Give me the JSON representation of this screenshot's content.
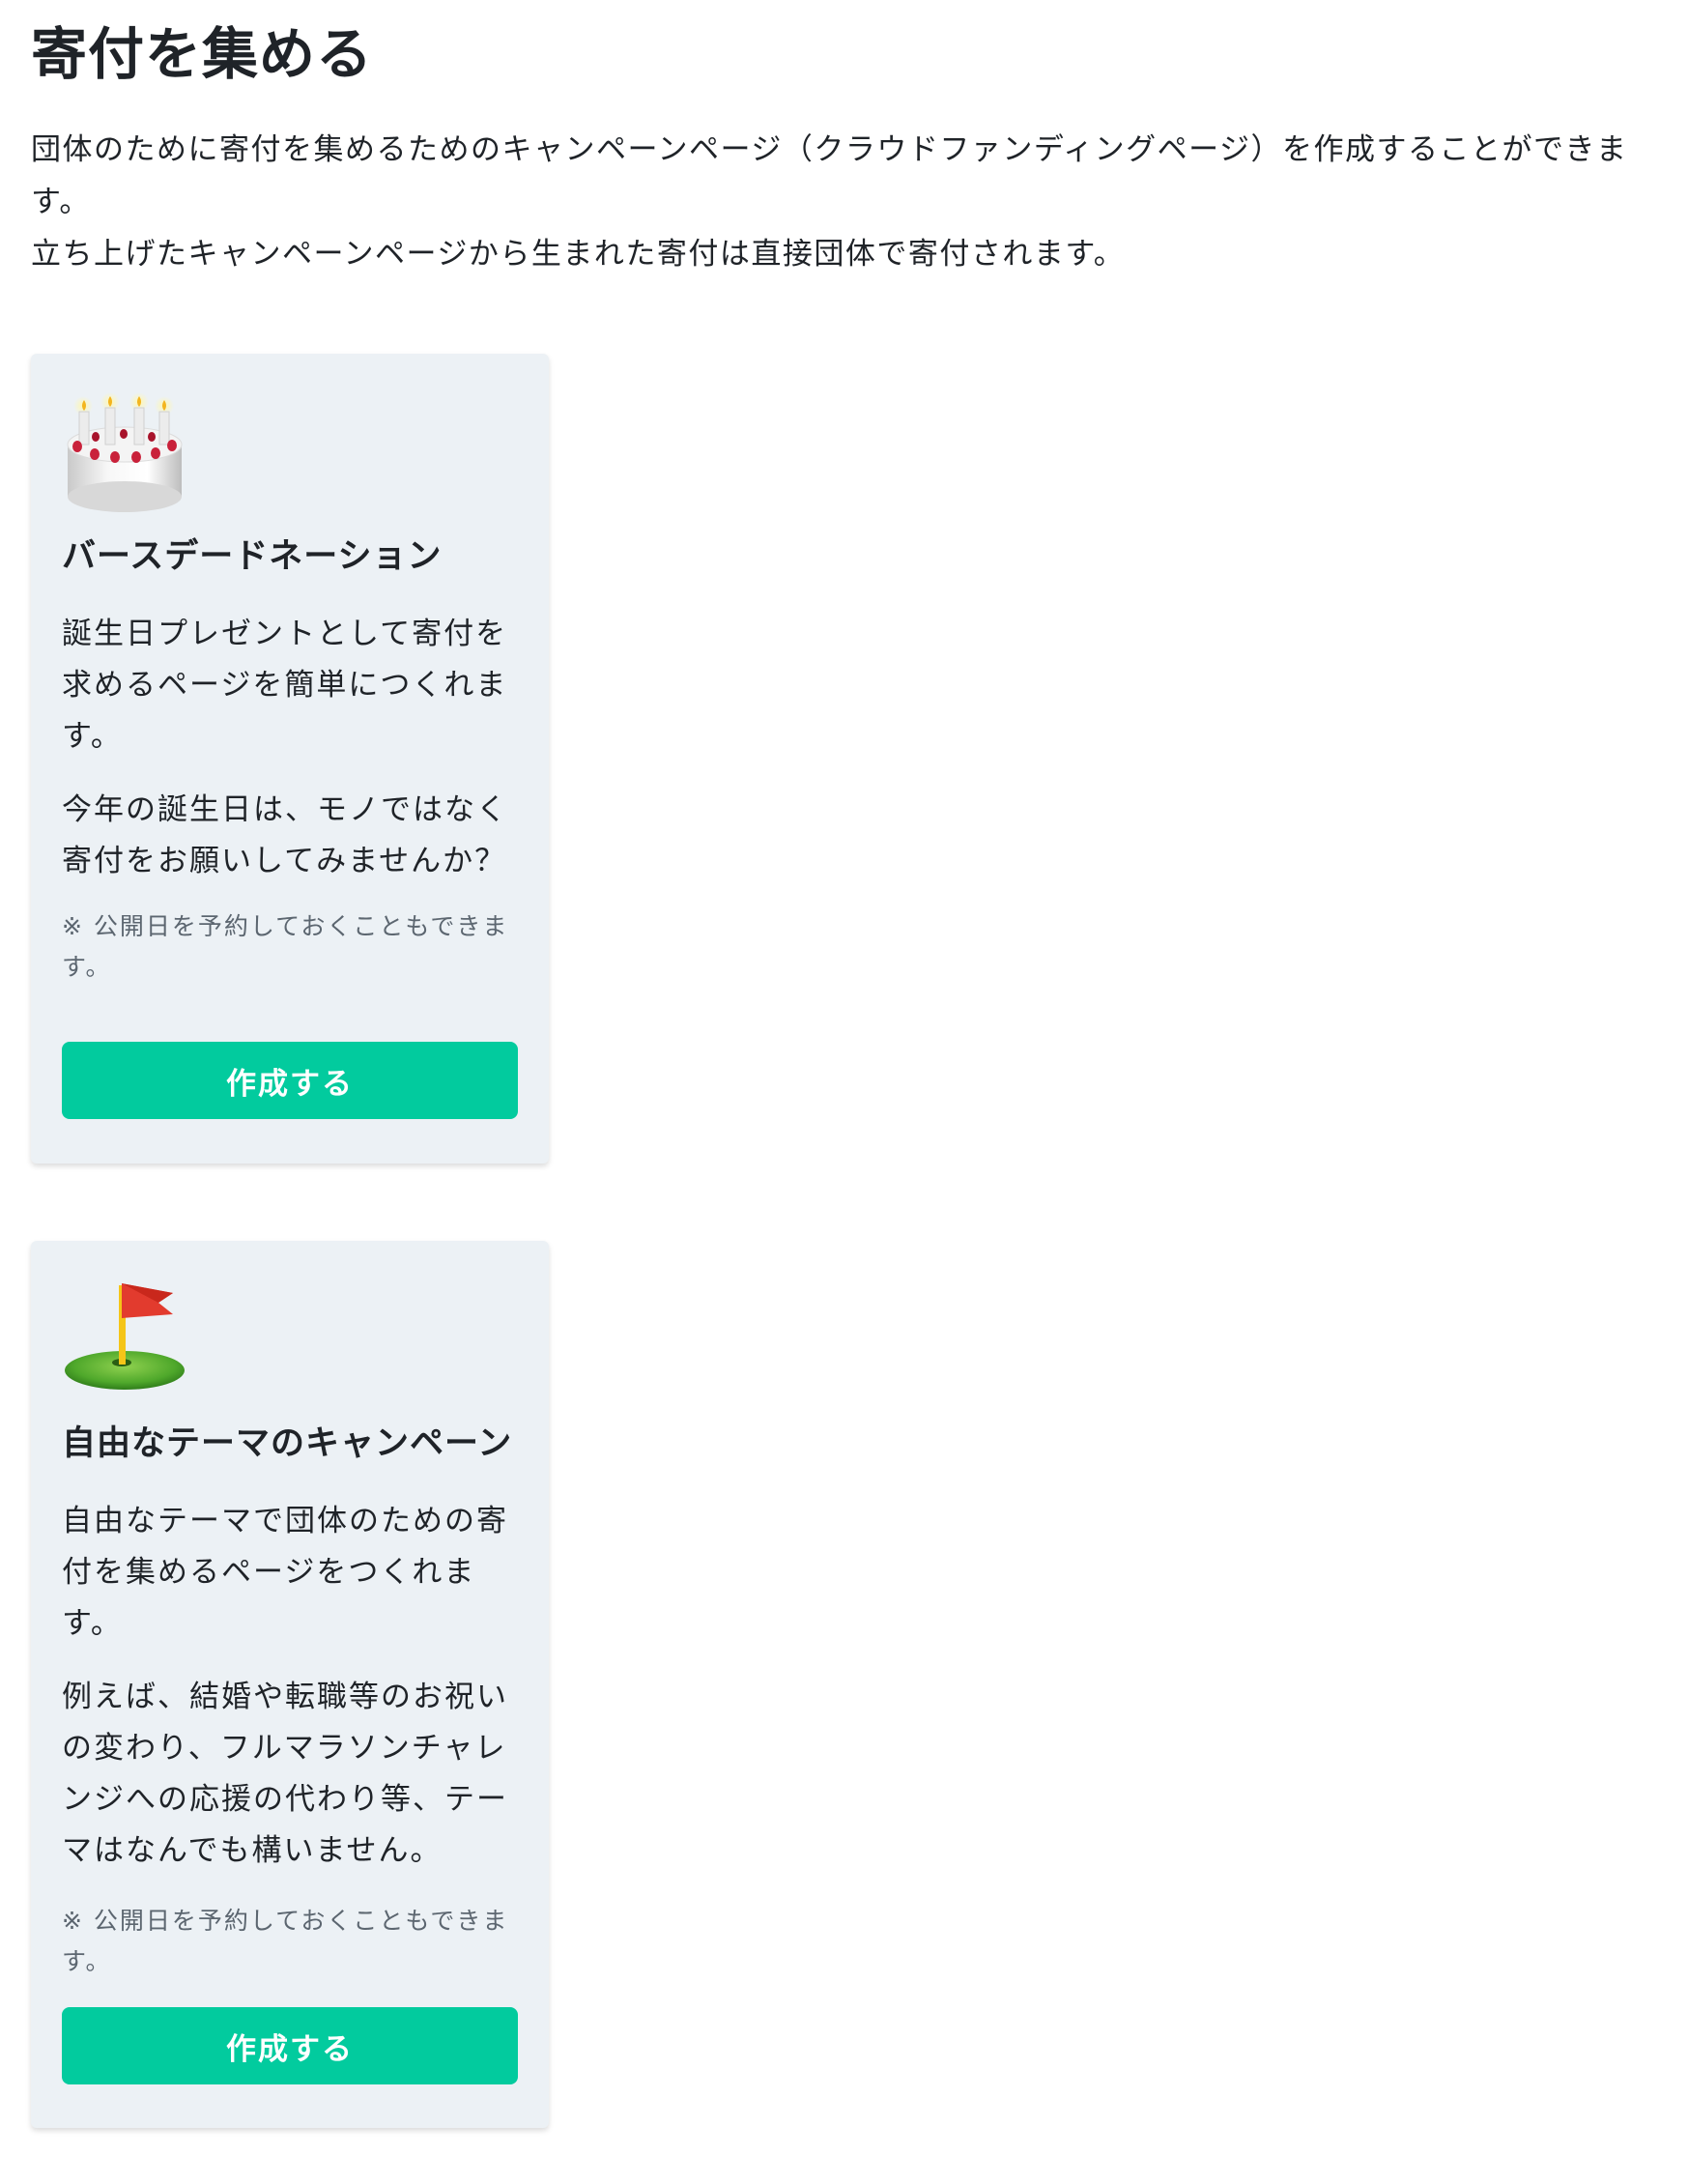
{
  "page": {
    "title": "寄付を集める",
    "description": [
      "団体のために寄付を集めるためのキャンペーンページ（クラウドファンディングページ）を作成することができます。",
      "立ち上げたキャンペーンページから生まれた寄付は直接団体で寄付されます。"
    ]
  },
  "cards": [
    {
      "icon": "birthday-cake-icon",
      "title": "バースデードネーション",
      "paragraphs": [
        "誕生日プレゼントとして寄付を求めるページを簡単につくれます。",
        "今年の誕生日は、モノではなく寄付をお願いしてみませんか？"
      ],
      "note": "※ 公開日を予約しておくこともできます。",
      "button_label": "作成する"
    },
    {
      "icon": "golf-flag-icon",
      "title": "自由なテーマのキャンペーン",
      "paragraphs": [
        "自由なテーマで団体のための寄付を集めるページをつくれます。",
        "例えば、結婚や転職等のお祝いの変わり、フルマラソンチャレンジへの応援の代わり等、テーマはなんでも構いません。"
      ],
      "note": "※ 公開日を予約しておくこともできます。",
      "button_label": "作成する"
    }
  ],
  "colors": {
    "button": "#02cb9e",
    "card_background": "#ecf1f5",
    "text": "#1f2328",
    "note": "#5c6670"
  }
}
